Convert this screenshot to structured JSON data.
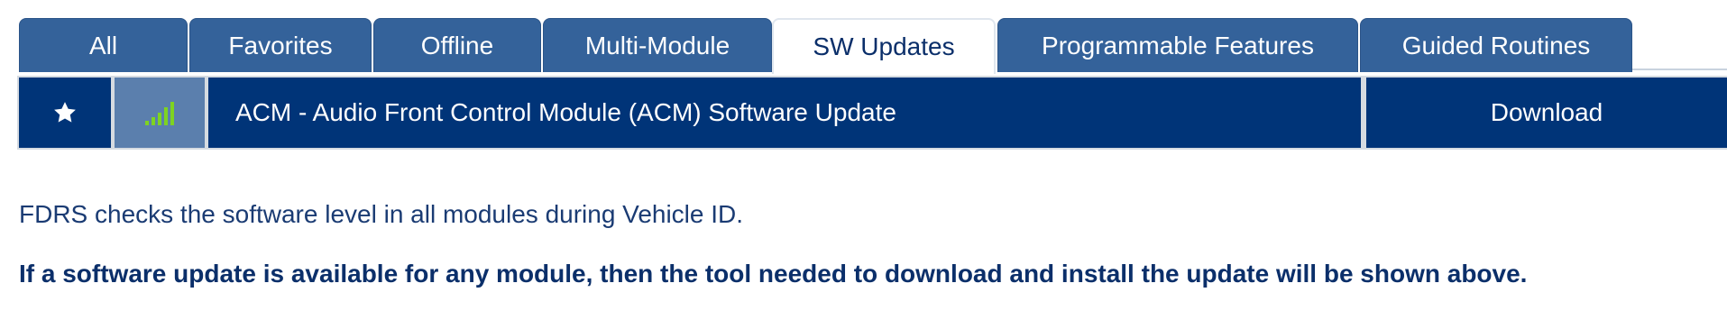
{
  "tabs": [
    {
      "label": "All",
      "active": false
    },
    {
      "label": "Favorites",
      "active": false
    },
    {
      "label": "Offline",
      "active": false
    },
    {
      "label": "Multi-Module",
      "active": false
    },
    {
      "label": "SW Updates",
      "active": true
    },
    {
      "label": "Programmable Features",
      "active": false
    },
    {
      "label": "Guided Routines",
      "active": false
    }
  ],
  "update_row": {
    "favorite_icon": "star-icon",
    "signal_icon": "signal-bars-icon",
    "signal_color": "#7ed321",
    "title": "ACM - Audio Front Control Module (ACM) Software Update",
    "action_label": "Download"
  },
  "info_text": "FDRS checks the software level in all modules during Vehicle ID.",
  "notice_text": "If a software update is available for any module, then the tool needed to download and install the update will be shown above.",
  "colors": {
    "tab_bg": "#34629a",
    "row_bg": "#003478",
    "signal_cell_bg": "#5b7fad",
    "text_dark": "#0b2f6a"
  }
}
